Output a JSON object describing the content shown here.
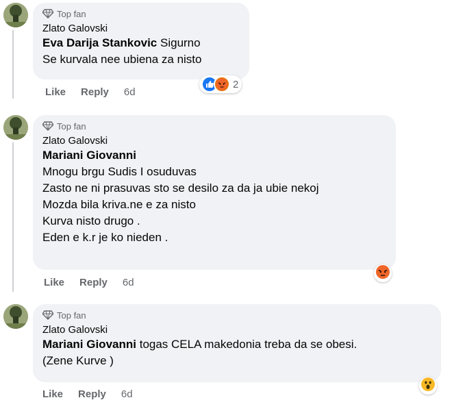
{
  "comments": [
    {
      "badge": "Top fan",
      "author": "Zlato Galovski",
      "mention": "Eva Darija Stankovic",
      "lines": [
        "Sigurno",
        "Se kurvala nee ubiena za nisto"
      ],
      "actions": {
        "like": "Like",
        "reply": "Reply",
        "time": "6d"
      },
      "reactions": {
        "icons": [
          "like-icon",
          "angry-icon"
        ],
        "count": "2"
      }
    },
    {
      "badge": "Top fan",
      "author": "Zlato Galovski",
      "mention": "Mariani Giovanni",
      "lines": [
        "Mnogu brgu Sudis I osuduvas",
        "Zasto ne ni prasuvas sto se desilo za da ja ubie nekoj",
        "Mozda bila kriva.ne e za nisto",
        "Kurva nisto drugo .",
        "Eden e k.r je ko nieden ."
      ],
      "actions": {
        "like": "Like",
        "reply": "Reply",
        "time": "6d"
      },
      "reactions": {
        "icons": [
          "angry-icon"
        ]
      }
    },
    {
      "badge": "Top fan",
      "author": "Zlato Galovski",
      "mention": "Mariani Giovanni",
      "lines": [
        "togas CELA makedonia treba da se obesi.",
        "(Zene Kurve )"
      ],
      "actions": {
        "like": "Like",
        "reply": "Reply",
        "time": "6d"
      },
      "reactions": {
        "icons": [
          "wow-icon"
        ]
      }
    }
  ],
  "colors": {
    "bubble": "#f0f2f5",
    "meta": "#65676b",
    "like_blue": "#1877f2",
    "angry": "#e9710f",
    "wow": "#f7b928"
  }
}
